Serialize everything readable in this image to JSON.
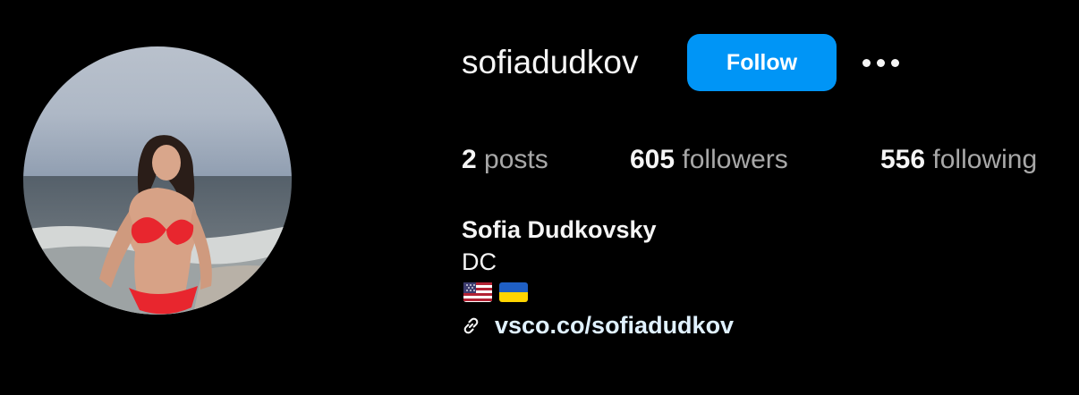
{
  "profile": {
    "username": "sofiadudkov",
    "follow_label": "Follow",
    "more_options_icon": "more-horizontal-icon",
    "stats": {
      "posts_count": "2",
      "posts_label": "posts",
      "followers_count": "605",
      "followers_label": "followers",
      "following_count": "556",
      "following_label": "following"
    },
    "full_name": "Sofia Dudkovsky",
    "bio_line": "DC",
    "bio_emojis": [
      "us-flag-icon",
      "ukraine-flag-icon"
    ],
    "link_icon": "link-icon",
    "link_text": "vsco.co/sofiadudkov"
  },
  "colors": {
    "background": "#000000",
    "follow_button": "#0095f6",
    "primary_text": "#f5f5f5",
    "secondary_text": "#a8a8a8",
    "link_text": "#e0f1ff"
  }
}
